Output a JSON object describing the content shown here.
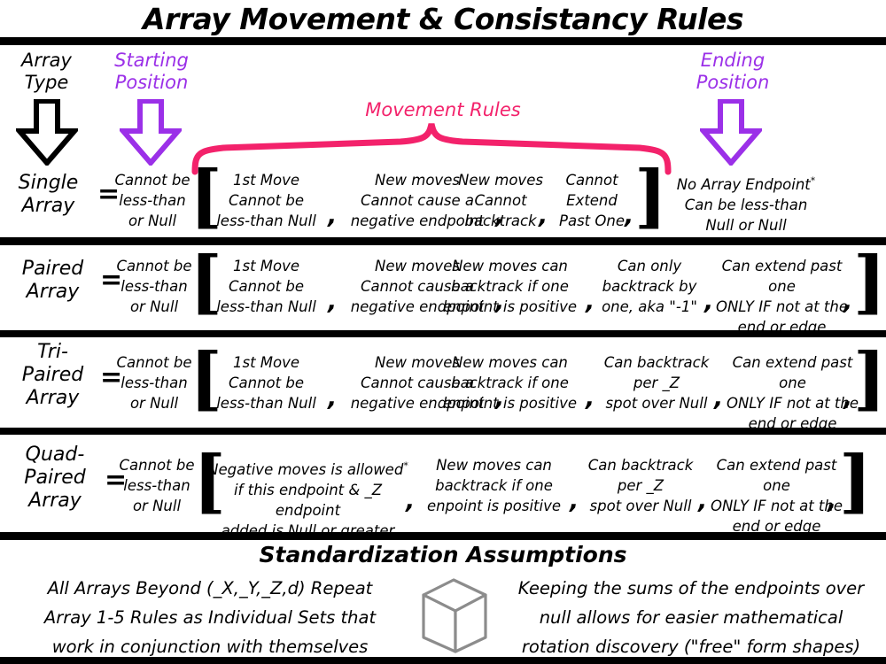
{
  "title": "Array Movement & Consistancy Rules",
  "colors": {
    "purple": "#9B30E8",
    "pink": "#F3226B",
    "black": "#000000",
    "cube_gray": "#8C8C8C"
  },
  "header": {
    "array_type": "Array\nType",
    "starting_position": "Starting\nPosition",
    "movement_rules": "Movement Rules",
    "ending_position": "Ending\nPosition",
    "arrows": {
      "array_type_arrow": "down-arrow-black",
      "starting_position_arrow": "down-arrow-purple",
      "ending_position_arrow": "down-arrow-purple",
      "movement_rules_brace": "pink-curly-brace"
    }
  },
  "equals_sign": "=",
  "comma": ",",
  "brackets": {
    "open": "[",
    "close": "]"
  },
  "rows": [
    {
      "type": "Single\nArray",
      "start": "Cannot be\nless-than\nor Null",
      "rules": [
        "1st Move\nCannot be\nless-than Null",
        "New moves\nCannot cause a\nnegative endpoint",
        "New moves\nCannot\nbacktrack",
        "Cannot\nExtend\nPast One"
      ],
      "end": "No Array Endpoint*\nCan be less-than\nNull or Null",
      "end_has_asterisk": true
    },
    {
      "type": "Paired\nArray",
      "start": "Cannot be\nless-than\nor Null",
      "rules": [
        "1st Move\nCannot be\nless-than Null",
        "New moves\nCannot cause a\nnegative endpoint",
        "New moves can\nbacktrack if one\nenpoint is positive",
        "Can only\nbacktrack by\none, aka \"-1\"",
        "Can extend past one\nONLY IF not at the\nend or edge"
      ],
      "end": "",
      "end_has_asterisk": false
    },
    {
      "type": "Tri-\nPaired\nArray",
      "start": "Cannot be\nless-than\nor Null",
      "rules": [
        "1st Move\nCannot be\nless-than Null",
        "New moves\nCannot cause a\nnegative endpoint",
        "New moves can\nbacktrack if one\nenpoint is positive",
        "Can backtrack\nper _Z\nspot over Null",
        "Can extend past one\nONLY IF not at the\nend or edge"
      ],
      "end": "",
      "end_has_asterisk": false
    },
    {
      "type": "Quad-\nPaired\nArray",
      "start": "Cannot be\nless-than\nor Null",
      "rules": [
        "Negative moves is allowed*\nif this endpoint & _Z endpoint\nadded is Null or greater",
        "New moves can\nbacktrack if one\nenpoint is positive",
        "Can backtrack\nper _Z\nspot over Null",
        "Can extend past one\nONLY IF not at the\nend or edge"
      ],
      "end": "",
      "end_has_asterisk": false
    }
  ],
  "footer": {
    "section_title": "Standardization Assumptions",
    "left_text": "All Arrays Beyond (_X,_Y,_Z,d) Repeat\nArray 1-5 Rules as Individual Sets that\nwork in conjunction with themselves",
    "cube_icon": "cube-icon",
    "right_text": "Keeping the sums of the endpoints over\nnull allows for easier mathematical\nrotation discovery (\"free\" form shapes)"
  }
}
